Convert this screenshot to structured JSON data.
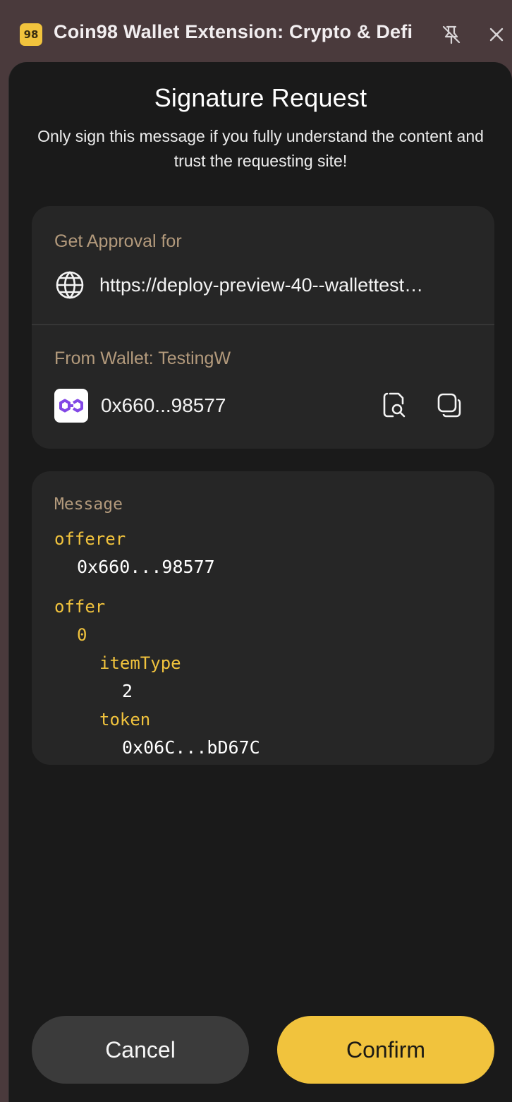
{
  "window": {
    "title": "Coin98 Wallet Extension: Crypto & Defi",
    "logo_text": "98",
    "icons": {
      "logo": "coin98-logo-icon",
      "pin": "unpin-icon",
      "close": "close-icon"
    }
  },
  "header": {
    "title": "Signature Request",
    "subtitle": "Only sign this message if you fully understand the content and trust the requesting site!"
  },
  "approval": {
    "label": "Get Approval for",
    "url": "https://deploy-preview-40--wallettest…",
    "url_icon": "globe-icon"
  },
  "wallet": {
    "label": "From Wallet: TestingW",
    "address": "0x660...98577",
    "chain_icon": "polygon-logo-icon",
    "icons": [
      "explorer-search-icon",
      "copy-icon"
    ]
  },
  "message": {
    "label": "Message",
    "entries": [
      {
        "key": "offerer",
        "value": "0x660...98577"
      },
      {
        "key": "offer",
        "index": "0",
        "fields": [
          {
            "key": "itemType",
            "value": "2"
          },
          {
            "key": "token",
            "value": "0x06C...bD67C"
          }
        ]
      }
    ]
  },
  "buttons": {
    "cancel": "Cancel",
    "confirm": "Confirm"
  },
  "colors": {
    "accent": "#F1C33D",
    "panel": "#1A1A1A",
    "card": "#262626",
    "muted_label": "#B39A7C",
    "window_bg": "#4A3A3C"
  }
}
